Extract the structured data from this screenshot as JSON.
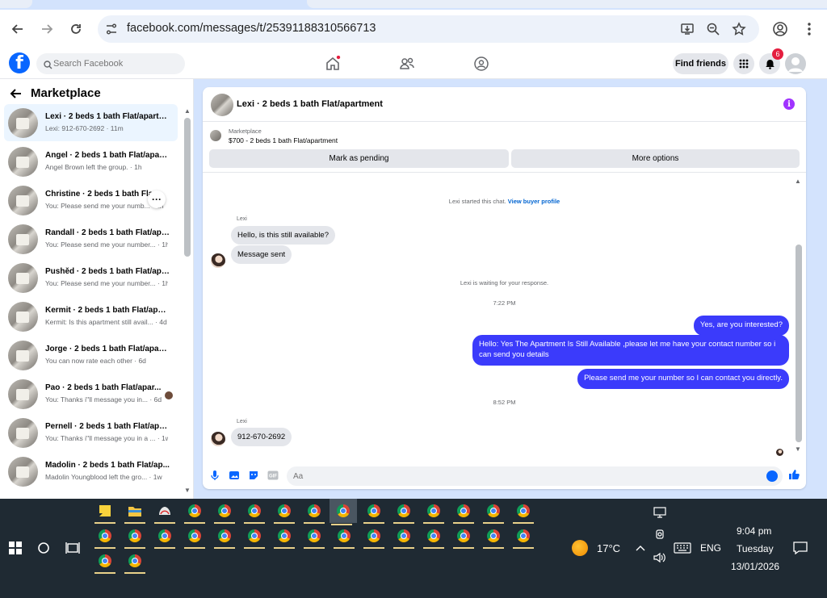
{
  "browser": {
    "url": "facebook.com/messages/t/25391188310566713"
  },
  "fb_nav": {
    "search_placeholder": "Search Facebook",
    "find_friends": "Find friends",
    "notif_count": "6"
  },
  "sidebar": {
    "title": "Marketplace",
    "conversations": [
      {
        "name": "Lexi · 2 beds 1 bath Flat/apartm...",
        "preview": "Lexi: 912-670-2692 · 11m"
      },
      {
        "name": "Angel · 2 beds 1 bath Flat/apart...",
        "preview": "Angel Brown left the group. · 1h"
      },
      {
        "name": "Christine · 2 beds 1 bath Fla...",
        "preview": "You: Please send me your numb... · 1h"
      },
      {
        "name": "Randall · 2 beds 1 bath Flat/apa...",
        "preview": "You: Please send me your number... · 1h"
      },
      {
        "name": "Pushěd · 2 beds 1 bath Flat/apa...",
        "preview": "You: Please send me your number... · 1h"
      },
      {
        "name": "Kermit · 2 beds 1 bath Flat/apart...",
        "preview": "Kermit: Is this apartment still avail... · 4d"
      },
      {
        "name": "Jorge · 2 beds 1 bath Flat/apart...",
        "preview": "You can now rate each other · 6d"
      },
      {
        "name": "Pao · 2 beds 1 bath Flat/apar...",
        "preview": "You: Thanks i''ll message you in... · 6d"
      },
      {
        "name": "Pernell · 2 beds 1 bath Flat/apa...",
        "preview": "You: Thanks i''ll message you in a ... · 1w"
      },
      {
        "name": "Madolin · 2 beds 1 bath Flat/ap...",
        "preview": "Madolin Youngblood left the gro... · 1w"
      }
    ]
  },
  "chat": {
    "title": "Lexi · 2 beds 1 bath Flat/apartment",
    "marketplace_label": "Marketplace",
    "listing": "$700 - 2 beds 1 bath Flat/apartment",
    "btn_pending": "Mark as pending",
    "btn_more": "More options",
    "sys_started": "Lexi started this chat.",
    "sys_link": "View buyer profile",
    "sender": "Lexi",
    "in_1": "Hello, is this still available?",
    "in_2": "Message sent",
    "sys_waiting": "Lexi is waiting for your response.",
    "time_1": "7:22 PM",
    "out_1": "Yes, are you interested?",
    "out_2": "Hello: Yes The Apartment Is Still Available ,please let me have your contact number so i can send you details",
    "out_3": "Please send me your number so I can contact you directly.",
    "time_2": "8:52 PM",
    "in_3": "912-670-2692",
    "composer_placeholder": "Aa"
  },
  "taskbar": {
    "weather": "17°C",
    "lang": "ENG",
    "time": "9:04 pm",
    "day": "Tuesday",
    "date": "13/01/2026"
  }
}
